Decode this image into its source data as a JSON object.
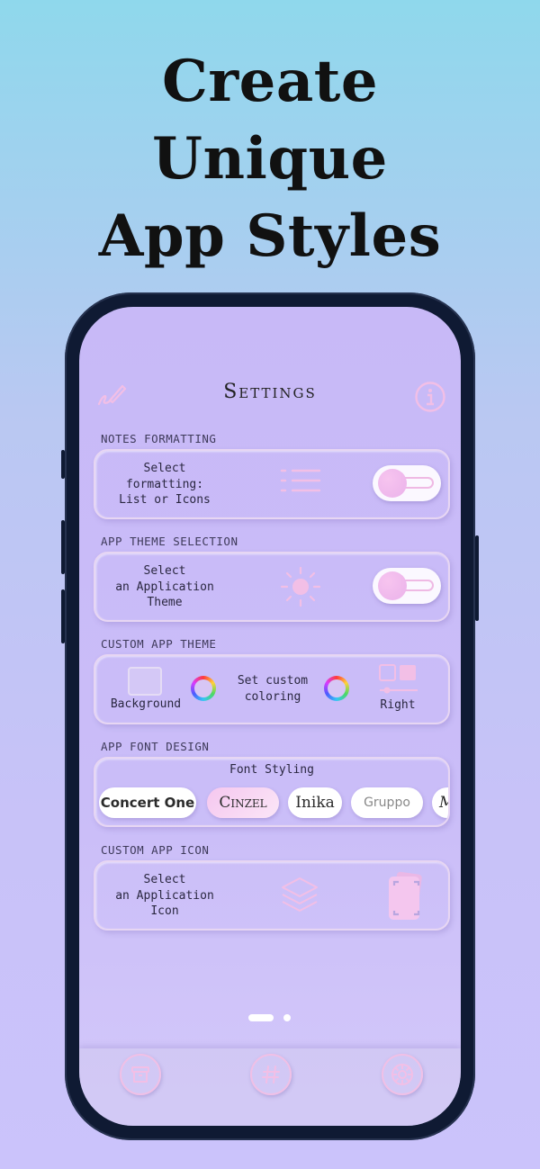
{
  "headline": {
    "line1": "Create",
    "line2": "Unique",
    "line3": "App Styles"
  },
  "header": {
    "title": "Settings",
    "left_icon": "pen-icon",
    "right_icon": "info-icon"
  },
  "sections": {
    "notes": {
      "label": "NOTES FORMATTING",
      "text1": "Select",
      "text2": "formatting:",
      "text3": "List or Icons",
      "icon": "list-icon"
    },
    "theme": {
      "label": "APP THEME SELECTION",
      "text1": "Select",
      "text2": "an Application",
      "text3": "Theme",
      "icon": "sun-icon"
    },
    "custom": {
      "label": "CUSTOM APP THEME",
      "background_label": "Background",
      "set_line1": "Set custom",
      "set_line2": "coloring",
      "right_label": "Right"
    },
    "font": {
      "label": "APP FONT DESIGN",
      "heading": "Font Styling",
      "chips": [
        "Concert One",
        "Cinzel",
        "Inika",
        "Gruppo",
        "M"
      ]
    },
    "icon": {
      "label": "CUSTOM APP ICON",
      "text1": "Select",
      "text2": "an Application",
      "text3": "Icon"
    }
  },
  "pager": {
    "pages": 2,
    "current": 1
  },
  "tabbar": {
    "items": [
      "archive-icon",
      "hashtag-icon",
      "settings-gear-icon"
    ]
  },
  "colors": {
    "accent": "#efb9e4",
    "card_border": "#e7d6f3",
    "screen_bg": "#c8b9f7",
    "phone_frame": "#0f1a33"
  }
}
